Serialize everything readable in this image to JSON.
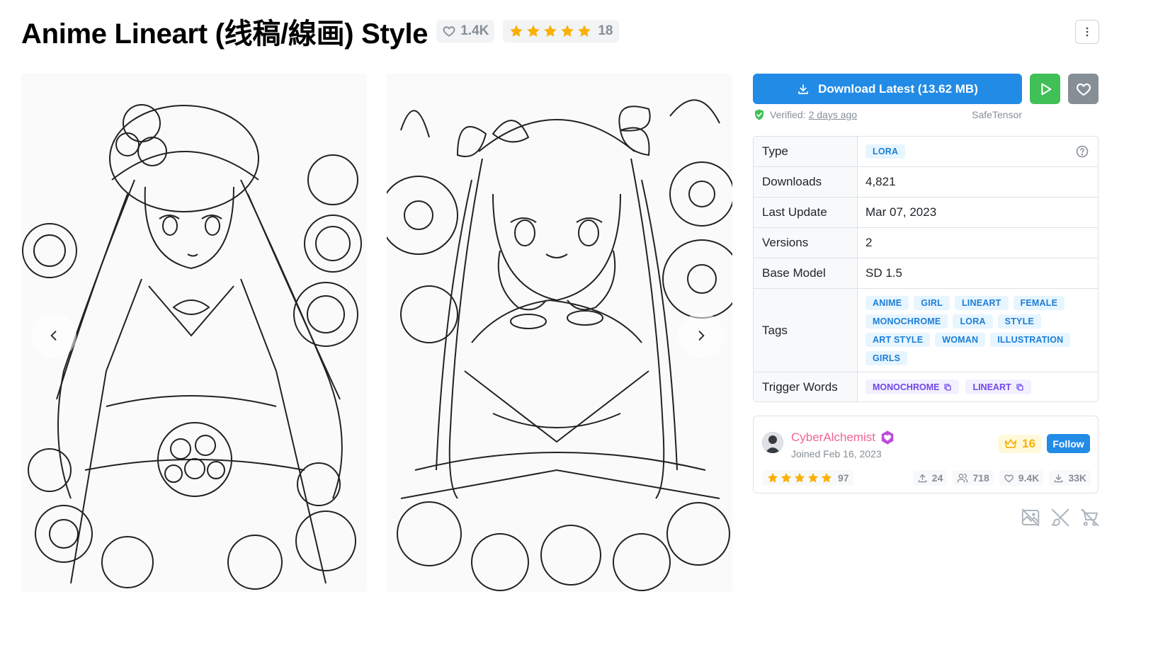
{
  "header": {
    "title": "Anime Lineart (线稿/線画) Style",
    "likes": "1.4K",
    "rating_count": "18",
    "star_color": "#fab005"
  },
  "side": {
    "download_label": "Download Latest (13.62 MB)",
    "verified_label": "Verified:",
    "verified_date": "2 days ago",
    "file_format": "SafeTensor"
  },
  "details": {
    "type_label": "Type",
    "type_value": "LORA",
    "downloads_label": "Downloads",
    "downloads_value": "4,821",
    "last_update_label": "Last Update",
    "last_update_value": "Mar 07, 2023",
    "versions_label": "Versions",
    "versions_value": "2",
    "base_model_label": "Base Model",
    "base_model_value": "SD 1.5",
    "tags_label": "Tags",
    "tags": [
      "ANIME",
      "GIRL",
      "LINEART",
      "FEMALE",
      "MONOCHROME",
      "LORA",
      "STYLE",
      "ART STYLE",
      "WOMAN",
      "ILLUSTRATION",
      "GIRLS"
    ],
    "trigger_label": "Trigger Words",
    "trigger_words": [
      "MONOCHROME",
      "LINEART"
    ]
  },
  "creator": {
    "name": "CyberAlchemist",
    "joined": "Joined Feb 16, 2023",
    "rank": "16",
    "follow_label": "Follow",
    "rating_count": "97",
    "uploads": "24",
    "followers": "718",
    "favorites": "9.4K",
    "downloads": "33K"
  },
  "colors": {
    "primary": "#228be6",
    "run": "#40c057",
    "fav": "#868e96",
    "creator_name": "#f06595"
  },
  "icons": {
    "like": "heart-icon",
    "star": "star-icon",
    "menu": "dots-vertical-icon",
    "download": "download-icon",
    "run": "play-icon",
    "fav": "heart-icon",
    "verified": "shield-check-icon",
    "help": "question-circle-icon",
    "copy": "copy-icon",
    "crown": "crown-icon",
    "upload": "upload-icon",
    "users": "users-icon",
    "no_images": "photo-off-icon",
    "no_brush": "brush-off-icon",
    "no_sell": "shopping-cart-off-icon"
  }
}
